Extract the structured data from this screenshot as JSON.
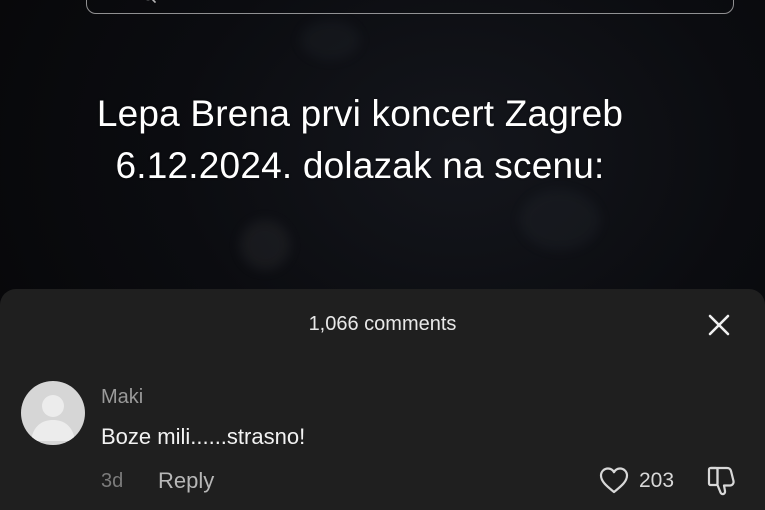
{
  "search": {
    "icon": "search-icon"
  },
  "video": {
    "caption_line_1": "Lepa Brena prvi koncert Zagreb",
    "caption_line_2": "6.12.2024. dolazak na scenu:"
  },
  "comments_sheet": {
    "count_label": "1,066 comments",
    "close_icon": "close-icon",
    "comments": [
      {
        "username": "Maki",
        "text": "Boze mili......strasno!",
        "timestamp": "3d",
        "reply_label": "Reply",
        "like_count": "203",
        "avatar_icon": "default-avatar-icon",
        "like_icon": "heart-outline-icon",
        "dislike_icon": "thumbs-down-icon"
      }
    ]
  },
  "colors": {
    "sheet_background": "#1f1f1f",
    "primary_text": "#f2f2f2",
    "secondary_text": "#9a9a9a"
  }
}
